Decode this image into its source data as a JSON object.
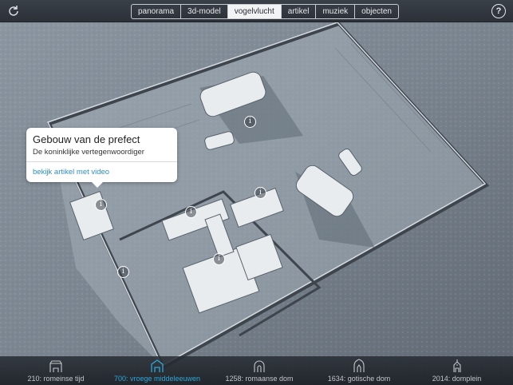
{
  "topbar": {
    "tabs": [
      "panorama",
      "3d-model",
      "vogelvlucht",
      "artikel",
      "muziek",
      "objecten"
    ],
    "active_tab": "vogelvlucht",
    "refresh_icon": "refresh-icon",
    "help_icon": "help-icon",
    "help_label": "?"
  },
  "popup": {
    "title": "Gebouw van de prefect",
    "subtitle": "De koninklijke vertegenwoordiger",
    "link": "bekijk artikel met video"
  },
  "hotspots": {
    "label": "i",
    "count": 6
  },
  "timeline": {
    "eras": [
      {
        "label": "210: romeinse tijd",
        "icon": "roman-gate-icon"
      },
      {
        "label": "700: vroege middeleeuwen",
        "icon": "early-medieval-icon"
      },
      {
        "label": "1258: romaanse dom",
        "icon": "romanesque-arch-icon"
      },
      {
        "label": "1634: gotische dom",
        "icon": "gothic-arch-icon"
      },
      {
        "label": "2014: domplein",
        "icon": "domplein-icon"
      }
    ],
    "active_index": 1,
    "active_color": "#2ea6d8"
  },
  "colors": {
    "accent": "#2ea6d8",
    "bar": "#2c3138"
  }
}
